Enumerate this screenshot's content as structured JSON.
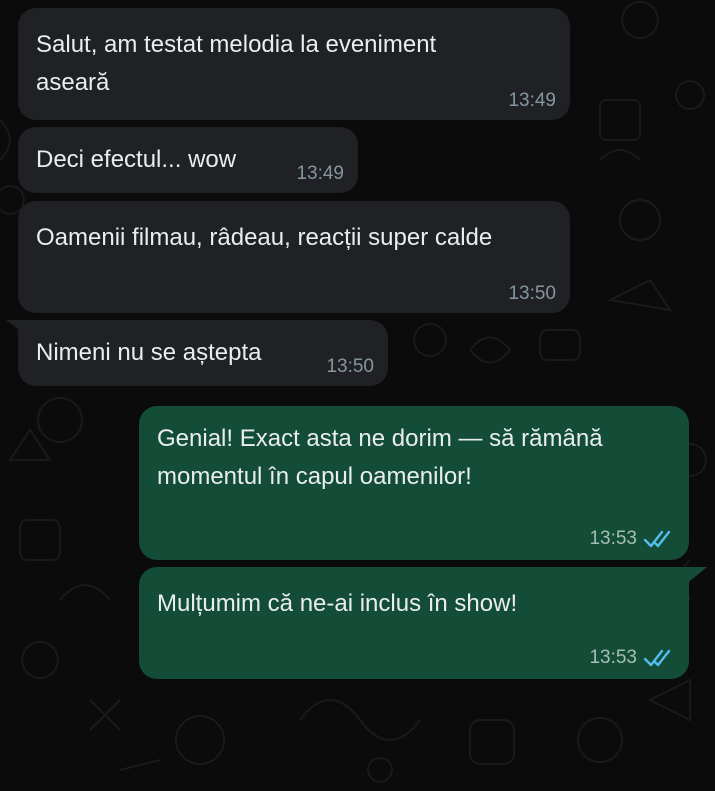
{
  "messages": [
    {
      "direction": "incoming",
      "text": "Salut, am testat melodia la eveniment aseară",
      "time": "13:49"
    },
    {
      "direction": "incoming",
      "text": "Deci efectul... wow",
      "time": "13:49"
    },
    {
      "direction": "incoming",
      "text": "Oamenii filmau, râdeau, reacții super calde",
      "time": "13:50"
    },
    {
      "direction": "incoming",
      "text": "Nimeni nu se aștepta",
      "time": "13:50"
    },
    {
      "direction": "outgoing",
      "text": "Genial! Exact asta ne dorim — să rămână momentul în capul oamenilor!",
      "time": "13:53",
      "status": "read"
    },
    {
      "direction": "outgoing",
      "text": "Mulțumim că ne-ai inclus în show!",
      "time": "13:53",
      "status": "read"
    }
  ],
  "colors": {
    "background": "#0b0b0b",
    "incoming_bubble": "#202124",
    "outgoing_bubble": "#144d37",
    "text": "#e9edef",
    "timestamp": "#8696a0",
    "read_ticks": "#53bdeb"
  },
  "icons": {
    "read_status": "double-check-icon"
  }
}
